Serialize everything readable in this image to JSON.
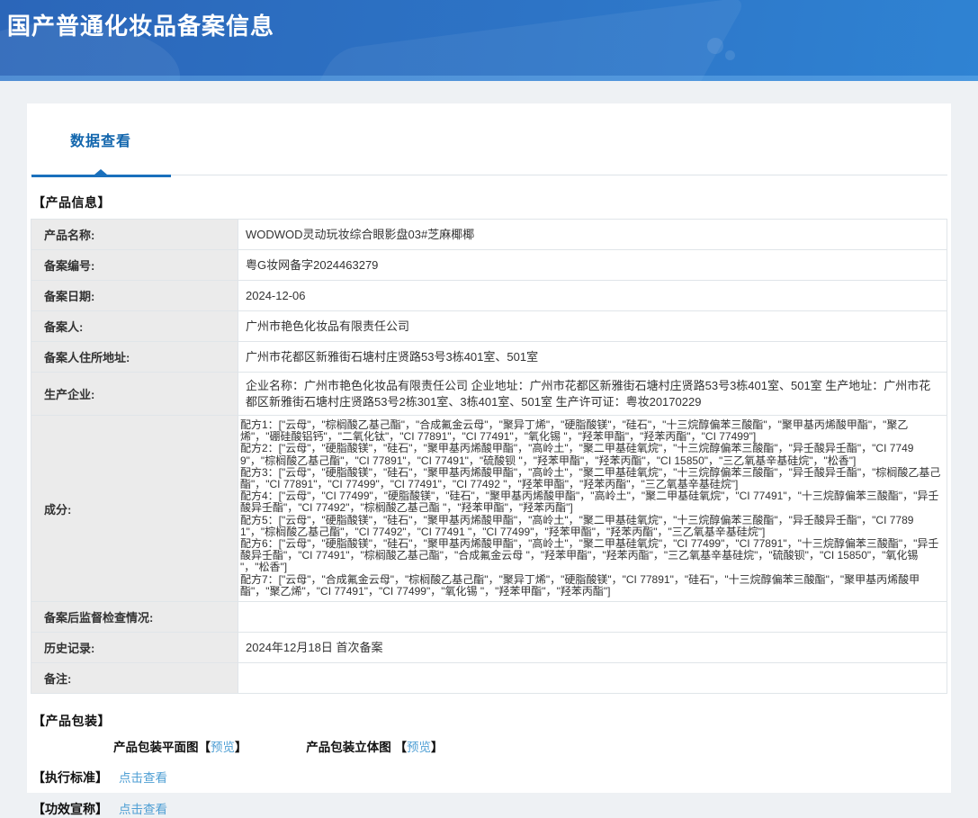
{
  "header": {
    "title": "国产普通化妆品备案信息"
  },
  "tabs": {
    "data_view": "数据查看"
  },
  "sections": {
    "product_info": "【产品信息】",
    "packaging": "【产品包装】",
    "standard": "【执行标准】",
    "efficacy": "【功效宣称】"
  },
  "table": {
    "rows": [
      {
        "label": "产品名称:",
        "value": "WODWOD灵动玩妆综合眼影盘03#芝麻椰椰"
      },
      {
        "label": "备案编号:",
        "value": "粤G妆网备字2024463279"
      },
      {
        "label": "备案日期:",
        "value": "2024-12-06"
      },
      {
        "label": "备案人:",
        "value": "广州市艳色化妆品有限责任公司"
      },
      {
        "label": "备案人住所地址:",
        "value": "广州市花都区新雅街石塘村庄贤路53号3栋401室、501室"
      },
      {
        "label": "生产企业:",
        "value": "企业名称：广州市艳色化妆品有限责任公司 企业地址：广州市花都区新雅街石塘村庄贤路53号3栋401室、501室 生产地址：广州市花都区新雅街石塘村庄贤路53号2栋301室、3栋401室、501室 生产许可证：粤妆20170229"
      },
      {
        "label": "成分:",
        "formulas": [
          "配方1：[\"云母\"，\"棕榈酸乙基己酯\"，\"合成氟金云母\"，\"聚异丁烯\"，\"硬脂酸镁\"，\"硅石\"，\"十三烷醇偏苯三酸酯\"，\"聚甲基丙烯酸甲酯\"，\"聚乙烯\"，\"硼硅酸铝钙\"，\"二氧化钛\"，\"CI 77891\"，\"CI 77491\"，\"氧化锡 \"，\"羟苯甲酯\"，\"羟苯丙酯\"，\"CI 77499\"]",
          "配方2：[\"云母\"，\"硬脂酸镁\"，\"硅石\"，\"聚甲基丙烯酸甲酯\"，\"高岭土\"，\"聚二甲基硅氧烷\"，\"十三烷醇偏苯三酸酯\"，\"异壬酸异壬酯\"，\"CI 77499\"，\"棕榈酸乙基己酯\"，\"CI 77891\"，\"CI 77491\"，\"硫酸钡 \"，\"羟苯甲酯\"，\"羟苯丙酯\"，\"CI 15850\"，\"三乙氧基辛基硅烷\"，\"松香\"]",
          "配方3：[\"云母\"，\"硬脂酸镁\"，\"硅石\"，\"聚甲基丙烯酸甲酯\"，\"高岭土\"，\"聚二甲基硅氧烷\"，\"十三烷醇偏苯三酸酯\"，\"异壬酸异壬酯\"，\"棕榈酸乙基己酯\"，\"CI 77891\"，\"CI 77499\"，\"CI 77491\"，\"CI 77492 \"，\"羟苯甲酯\"，\"羟苯丙酯\"，\"三乙氧基辛基硅烷\"]",
          "配方4：[\"云母\"，\"CI 77499\"，\"硬脂酸镁\"，\"硅石\"，\"聚甲基丙烯酸甲酯\"，\"高岭土\"，\"聚二甲基硅氧烷\"，\"CI 77491\"，\"十三烷醇偏苯三酸酯\"，\"异壬酸异壬酯\"，\"CI 77492\"，\"棕榈酸乙基己酯 \"，\"羟苯甲酯\"，\"羟苯丙酯\"]",
          "配方5：[\"云母\"，\"硬脂酸镁\"，\"硅石\"，\"聚甲基丙烯酸甲酯\"，\"高岭土\"，\"聚二甲基硅氧烷\"，\"十三烷醇偏苯三酸酯\"，\"异壬酸异壬酯\"，\"CI 77891\"，\"棕榈酸乙基己酯\"，\"CI 77492\"，\"CI 77491 \"，\"CI 77499\"，\"羟苯甲酯\"，\"羟苯丙酯\"，\"三乙氧基辛基硅烷\"]",
          "配方6：[\"云母\"，\"硬脂酸镁\"，\"硅石\"，\"聚甲基丙烯酸甲酯\"，\"高岭土\"，\"聚二甲基硅氧烷\"，\"CI 77499\"，\"CI 77891\"，\"十三烷醇偏苯三酸酯\"，\"异壬酸异壬酯\"，\"CI 77491\"，\"棕榈酸乙基己酯\"，\"合成氟金云母 \"，\"羟苯甲酯\"，\"羟苯丙酯\"，\"三乙氧基辛基硅烷\"，\"硫酸钡\"，\"CI 15850\"，\"氧化锡 \"，\"松香\"]",
          "配方7：[\"云母\"，\"合成氟金云母\"，\"棕榈酸乙基己酯\"，\"聚异丁烯\"，\"硬脂酸镁\"，\"CI 77891\"，\"硅石\"，\"十三烷醇偏苯三酸酯\"，\"聚甲基丙烯酸甲酯\"，\"聚乙烯\"，\"CI 77491\"，\"CI 77499\"，\"氧化锡 \"，\"羟苯甲酯\"，\"羟苯丙酯\"]"
        ]
      },
      {
        "label": "备案后监督检查情况:",
        "value": ""
      },
      {
        "label": "历史记录:",
        "value": "2024年12月18日 首次备案"
      },
      {
        "label": "备注:",
        "value": ""
      }
    ]
  },
  "packaging": {
    "flat_label": "产品包装平面图",
    "solid_label": "产品包装立体图",
    "bracket_open": "【",
    "bracket_close": "】",
    "preview_link": "预览"
  },
  "links": {
    "view_label": "点击查看"
  },
  "colors": {
    "accent_blue": "#1a70bc",
    "link_blue": "#4f9fd4",
    "header_blue_start": "#2b66b9",
    "header_blue_end": "#2f83d3",
    "label_cell_bg": "#ebebeb"
  }
}
